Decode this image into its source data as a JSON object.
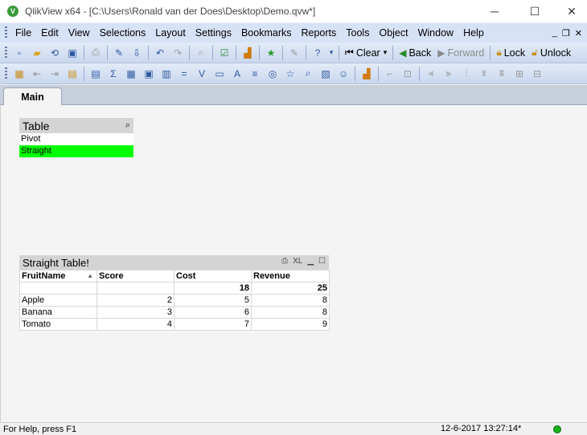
{
  "window": {
    "app_icon": "V",
    "title": "QlikView x64 - [C:\\Users\\Ronald van der Does\\Desktop\\Demo.qvw*]",
    "minimize_icon": "─",
    "maximize_icon": "☐",
    "close_icon": "✕"
  },
  "menu": {
    "items": [
      "File",
      "Edit",
      "View",
      "Selections",
      "Layout",
      "Settings",
      "Bookmarks",
      "Reports",
      "Tools",
      "Object",
      "Window",
      "Help"
    ],
    "mdi_minimize": "_",
    "mdi_restore": "❐",
    "mdi_close": "✕"
  },
  "toolbar1": {
    "icons": [
      "new-icon",
      "open-icon",
      "reload-icon",
      "save-icon",
      "print-icon",
      "edit-script-icon",
      "reload-data-icon",
      "undo-icon",
      "redo-icon",
      "search-icon",
      "apply-icon",
      "chart-icon",
      "bookmark-star-icon",
      "edit-icon",
      "help-icon"
    ],
    "clear_label": "Clear",
    "back_label": "Back",
    "forward_label": "Forward",
    "lock_label": "Lock",
    "unlock_label": "Unlock"
  },
  "toolbar2": {
    "icons": [
      "new-sheet-icon",
      "promote-sheet-icon",
      "demote-sheet-icon",
      "sheet-properties-icon",
      "listbox-icon",
      "statistics-box-icon",
      "table-box-icon",
      "multibox-icon",
      "chart-object-icon",
      "input-box-icon",
      "current-selections-icon",
      "button-icon",
      "text-object-icon",
      "line-arrow-icon",
      "slider-icon",
      "bookmark-object-icon",
      "search-object-icon",
      "container-icon",
      "custom-object-icon",
      "server-object-icon",
      "format-painter-icon",
      "align-left-icon",
      "align-center-icon",
      "align-right-icon",
      "align-top-icon",
      "align-middle-icon",
      "align-bottom-icon",
      "space-horizontal-icon",
      "space-vertical-icon"
    ]
  },
  "tabs": [
    {
      "label": "Main",
      "active": true
    }
  ],
  "listbox": {
    "title": "Table",
    "search_icon": "⌕",
    "items": [
      {
        "label": "Pivot",
        "state": "optional"
      },
      {
        "label": "Straight",
        "state": "selected"
      }
    ]
  },
  "straight_table": {
    "title": "Straight Table!",
    "columns": [
      "FruitName",
      "Score",
      "Cost",
      "Revenue"
    ],
    "sort_indicator": "▲",
    "totals": [
      "",
      "",
      "18",
      "25"
    ],
    "rows": [
      [
        "Apple",
        "2",
        "5",
        "8"
      ],
      [
        "Banana",
        "3",
        "6",
        "8"
      ],
      [
        "Tomato",
        "4",
        "7",
        "9"
      ]
    ],
    "icons": {
      "print": "⎙",
      "xl": "XL",
      "minimize": "▁",
      "maximize": "☐"
    }
  },
  "status": {
    "help": "For Help, press F1",
    "timestamp": "12-6-2017 13:27:14*"
  },
  "colors": {
    "selected": "#00ff00",
    "optional": "#ffffff",
    "menubar": "#d6e2f5"
  }
}
